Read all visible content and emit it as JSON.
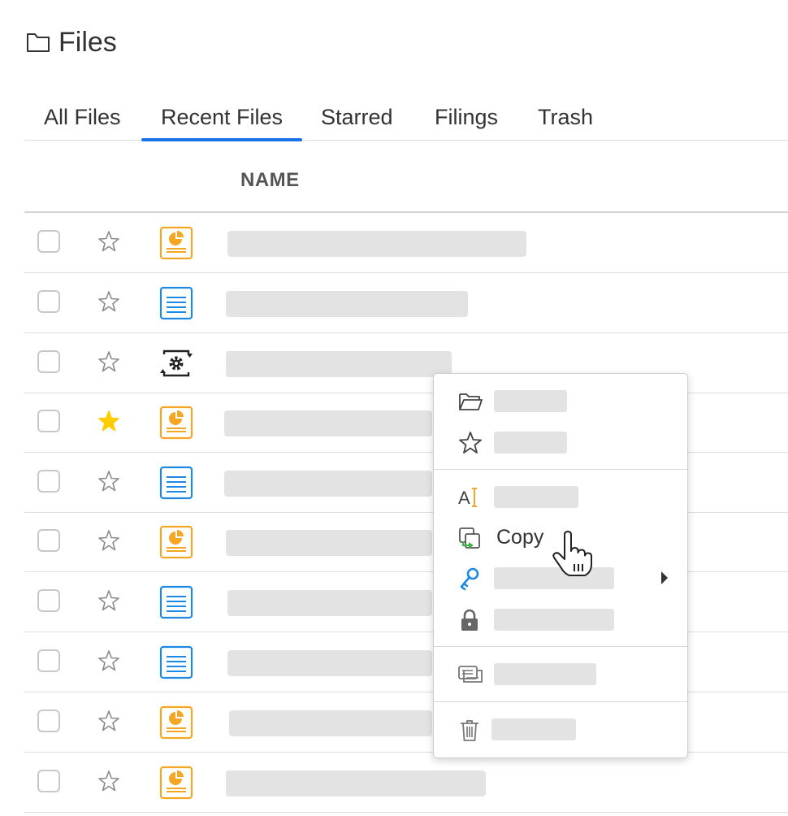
{
  "header": {
    "title": "Files",
    "icon": "folder-icon"
  },
  "tabs": [
    {
      "label": "All Files",
      "active": false
    },
    {
      "label": "Recent Files",
      "active": true
    },
    {
      "label": "Starred",
      "active": false
    },
    {
      "label": "Filings",
      "active": false
    },
    {
      "label": "Trash",
      "active": false
    }
  ],
  "columns": {
    "name": "NAME"
  },
  "rows": [
    {
      "starred": false,
      "file_icon": "presentation-icon"
    },
    {
      "starred": false,
      "file_icon": "document-icon"
    },
    {
      "starred": false,
      "file_icon": "workflow-gear-icon"
    },
    {
      "starred": true,
      "file_icon": "presentation-icon"
    },
    {
      "starred": false,
      "file_icon": "document-icon"
    },
    {
      "starred": false,
      "file_icon": "presentation-icon"
    },
    {
      "starred": false,
      "file_icon": "document-icon"
    },
    {
      "starred": false,
      "file_icon": "document-icon"
    },
    {
      "starred": false,
      "file_icon": "presentation-icon"
    },
    {
      "starred": false,
      "file_icon": "presentation-icon"
    }
  ],
  "context_menu": {
    "items": [
      {
        "icon": "folder-open-icon",
        "label": ""
      },
      {
        "icon": "star-icon",
        "label": ""
      },
      {
        "icon": "rename-icon",
        "label": ""
      },
      {
        "icon": "copy-icon",
        "label": "Copy"
      },
      {
        "icon": "key-icon",
        "label": "",
        "has_submenu": true
      },
      {
        "icon": "lock-icon",
        "label": ""
      },
      {
        "icon": "comments-icon",
        "label": ""
      },
      {
        "icon": "trash-icon",
        "label": ""
      }
    ]
  },
  "colors": {
    "accent": "#1a73e8",
    "presentation_icon": "#f5a623",
    "document_icon": "#1e88e5",
    "starred": "#ffcc00"
  }
}
